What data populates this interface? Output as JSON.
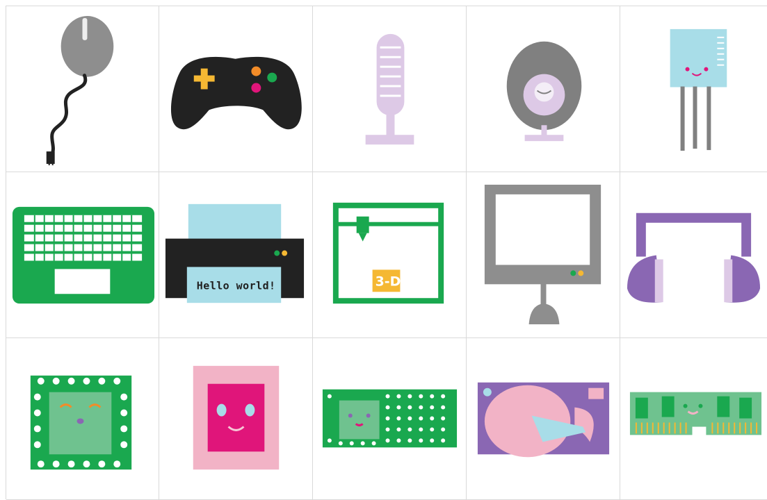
{
  "tiles": [
    {
      "icon": "computer-mouse-icon"
    },
    {
      "icon": "game-controller-icon"
    },
    {
      "icon": "microphone-icon"
    },
    {
      "icon": "webcam-icon"
    },
    {
      "icon": "sensor-chip-icon"
    },
    {
      "icon": "laptop-keyboard-icon"
    },
    {
      "icon": "printer-icon"
    },
    {
      "icon": "3d-printer-icon"
    },
    {
      "icon": "monitor-icon"
    },
    {
      "icon": "headphones-icon"
    },
    {
      "icon": "cpu-chip-icon"
    },
    {
      "icon": "microchip-icon"
    },
    {
      "icon": "circuit-board-icon"
    },
    {
      "icon": "hard-drive-icon"
    },
    {
      "icon": "ram-module-icon"
    }
  ],
  "printer": {
    "text": "Hello world!"
  },
  "printer3d": {
    "label": "3-D"
  },
  "colors": {
    "green": "#1aa84f",
    "light_green": "#6fc28f",
    "pink": "#f2b3c6",
    "magenta": "#e0157a",
    "purple": "#8a67b3",
    "lavender": "#ddc9e6",
    "light_blue": "#a8dde8",
    "gray": "#8a8a8a",
    "black": "#222222",
    "yellow": "#f6b93b"
  }
}
